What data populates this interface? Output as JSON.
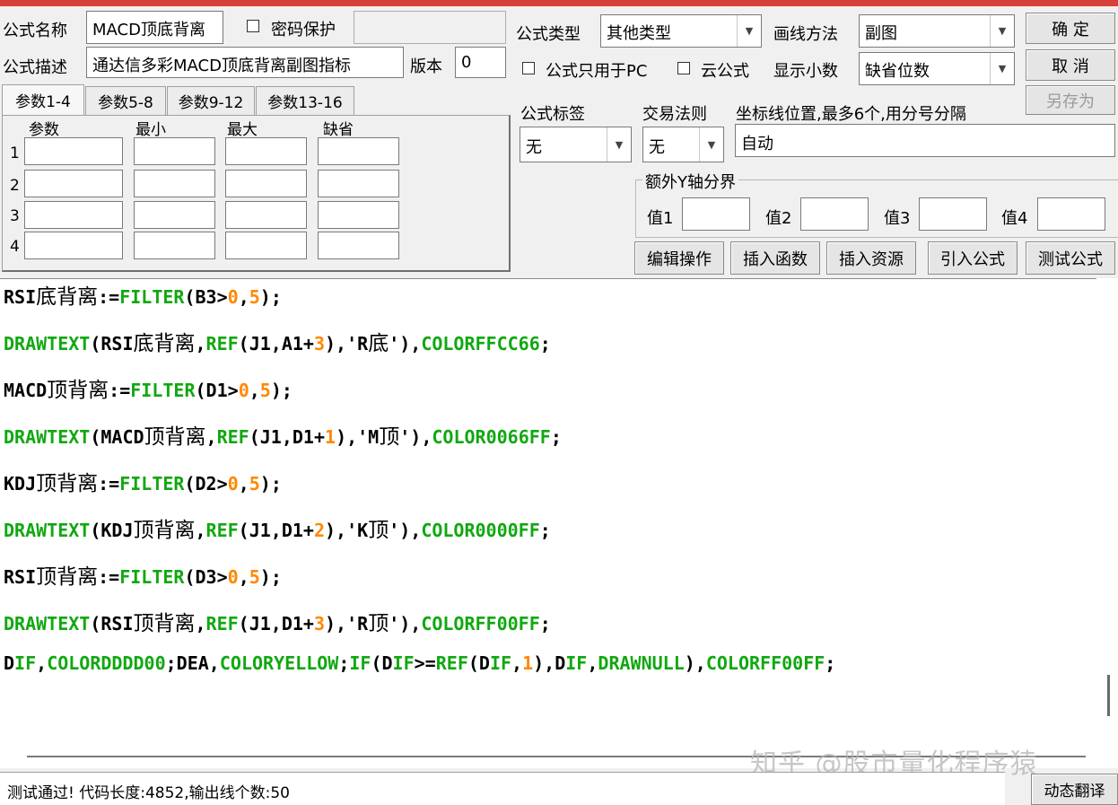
{
  "header": {
    "name_label": "公式名称",
    "name_value": "MACD顶底背离",
    "password_label": "密码保护",
    "type_label": "公式类型",
    "type_value": "其他类型",
    "draw_label": "画线方法",
    "draw_value": "副图",
    "desc_label": "公式描述",
    "desc_value": "通达信多彩MACD顶底背离副图指标",
    "version_label": "版本",
    "version_value": "0",
    "pc_only_label": "公式只用于PC",
    "cloud_label": "云公式",
    "decimals_label": "显示小数",
    "decimals_value": "缺省位数"
  },
  "buttons": {
    "ok": "确  定",
    "cancel": "取  消",
    "save_as": "另存为",
    "edit_ops": "编辑操作",
    "insert_func": "插入函数",
    "insert_res": "插入资源",
    "import_formula": "引入公式",
    "test_formula": "测试公式"
  },
  "tabs": [
    "参数1-4",
    "参数5-8",
    "参数9-12",
    "参数13-16"
  ],
  "params": {
    "headers": [
      "参数",
      "最小",
      "最大",
      "缺省"
    ],
    "rows": [
      "1",
      "2",
      "3",
      "4"
    ]
  },
  "right_panel": {
    "tag_label": "公式标签",
    "tag_value": "无",
    "trade_label": "交易法则",
    "trade_value": "无",
    "coord_label": "坐标线位置,最多6个,用分号分隔",
    "coord_value": "自动",
    "yaxis_group": "额外Y轴分界",
    "vals": [
      "值1",
      "值2",
      "值3",
      "值4"
    ]
  },
  "code_lines": [
    "RSI底背离:=FILTER(B3>0,5);",
    "DRAWTEXT(RSI底背离,REF(J1,A1+3),'R底'),COLORFFCC66;",
    "MACD顶背离:=FILTER(D1>0,5);",
    "DRAWTEXT(MACD顶背离,REF(J1,D1+1),'M顶'),COLOR0066FF;",
    "KDJ顶背离:=FILTER(D2>0,5);",
    "DRAWTEXT(KDJ顶背离,REF(J1,D1+2),'K顶'),COLOR0000FF;",
    "RSI顶背离:=FILTER(D3>0,5);",
    "DRAWTEXT(RSI顶背离,REF(J1,D1+3),'R顶'),COLORFF00FF;",
    "DIF,COLORDDDD00;DEA,COLORYELLOW;IF(DIF>=REF(DIF,1),DIF,DRAWNULL),COLORFF00FF;"
  ],
  "watermark": "知乎 @股市量化程序猿",
  "status_text": "测试通过! 代码长度:4852,输出线个数:50",
  "translate_button": "动态翻译",
  "colors": {
    "title_bar": "#d8403a",
    "keyword": "#10a810",
    "number": "#ff8800"
  }
}
